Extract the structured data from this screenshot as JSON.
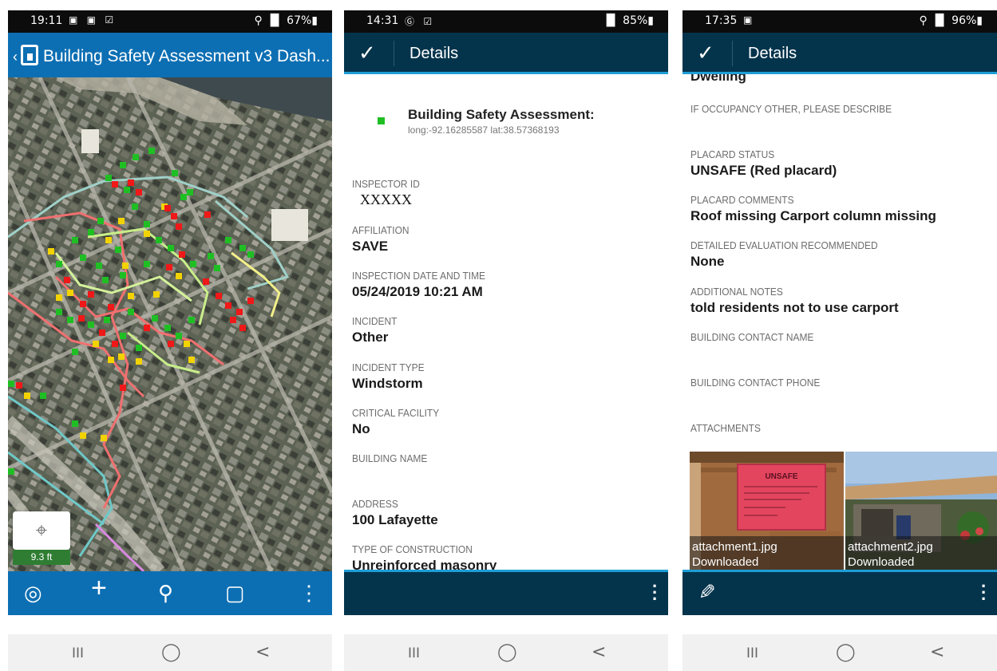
{
  "phone1": {
    "status": {
      "time": "19:11",
      "left_icons": "▣ ▣ ☑",
      "right": "⚲ ▐▌ 67%▮"
    },
    "appbar": {
      "title": "Building Safety Assessment v3 Dash...",
      "back_icon": "chevron-left-icon",
      "app_icon": "dashboard-icon"
    },
    "map": {
      "scale": "9.3 ft",
      "locate_icon": "crosshair-icon"
    },
    "toolbar": {
      "locate": "◎",
      "add": "+",
      "search": "⚲",
      "bookmark": "▢",
      "more": "⋮"
    },
    "nav": {
      "recent": "III",
      "home": "◯",
      "back": "<"
    }
  },
  "phone2": {
    "status": {
      "time": "14:31",
      "left_icons": "Ⓖ ☑",
      "right": "▐▌ 85%▮"
    },
    "appbar": {
      "check": "✓",
      "title": "Details"
    },
    "header": {
      "title": "Building Safety Assessment:",
      "coords": "long:-92.16285587 lat:38.57368193"
    },
    "fields": [
      {
        "label": "INSPECTOR ID",
        "value": "XXXXX"
      },
      {
        "label": "AFFILIATION",
        "value": "SAVE"
      },
      {
        "label": "INSPECTION DATE AND TIME",
        "value": "05/24/2019 10:21 AM"
      },
      {
        "label": "INCIDENT",
        "value": "Other"
      },
      {
        "label": "INCIDENT TYPE",
        "value": "Windstorm"
      },
      {
        "label": "CRITICAL FACILITY",
        "value": "No"
      },
      {
        "label": "BUILDING NAME",
        "value": ""
      },
      {
        "label": "ADDRESS",
        "value": "100 Lafayette"
      },
      {
        "label": "TYPE OF CONSTRUCTION",
        "value": "Unreinforced masonry"
      }
    ],
    "nav": {
      "recent": "III",
      "home": "◯",
      "back": "<"
    }
  },
  "phone3": {
    "status": {
      "time": "17:35",
      "left_icons": "▣",
      "right": "⚲ ▐▌ 96%▮"
    },
    "appbar": {
      "check": "✓",
      "title": "Details"
    },
    "top_value": "Dwelling",
    "fields": [
      {
        "label": "IF OCCUPANCY OTHER, PLEASE DESCRIBE",
        "value": ""
      },
      {
        "label": "PLACARD STATUS",
        "value": "UNSAFE (Red placard)"
      },
      {
        "label": "PLACARD COMMENTS",
        "value": "Roof missing Carport column missing"
      },
      {
        "label": "DETAILED EVALUATION RECOMMENDED",
        "value": "None"
      },
      {
        "label": "ADDITIONAL NOTES",
        "value": "told residents not to use carport"
      },
      {
        "label": "BUILDING CONTACT NAME",
        "value": ""
      },
      {
        "label": "BUILDING CONTACT PHONE",
        "value": ""
      },
      {
        "label": "ATTACHMENTS",
        "value": ""
      }
    ],
    "attachments": [
      {
        "name": "attachment1.jpg",
        "status": "Downloaded",
        "sign": "UNSAFE"
      },
      {
        "name": "attachment2.jpg",
        "status": "Downloaded"
      }
    ],
    "toolbar": {
      "edit": "✎"
    },
    "nav": {
      "recent": "III",
      "home": "◯",
      "back": "<"
    }
  },
  "colors": {
    "app_blue": "#0d6fb3",
    "dark_navy": "#04344c",
    "accent": "#1e9ed6",
    "safe": "#1fbf24",
    "restricted": "#f2d300",
    "unsafe": "#f01818"
  }
}
